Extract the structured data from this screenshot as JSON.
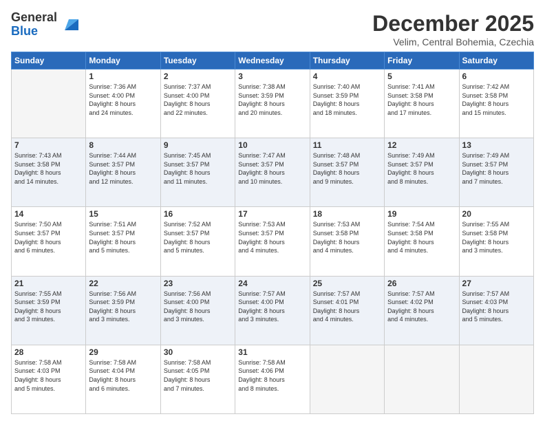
{
  "logo": {
    "general": "General",
    "blue": "Blue"
  },
  "header": {
    "month": "December 2025",
    "location": "Velim, Central Bohemia, Czechia"
  },
  "days_of_week": [
    "Sunday",
    "Monday",
    "Tuesday",
    "Wednesday",
    "Thursday",
    "Friday",
    "Saturday"
  ],
  "weeks": [
    [
      {
        "day": "",
        "info": ""
      },
      {
        "day": "1",
        "info": "Sunrise: 7:36 AM\nSunset: 4:00 PM\nDaylight: 8 hours\nand 24 minutes."
      },
      {
        "day": "2",
        "info": "Sunrise: 7:37 AM\nSunset: 4:00 PM\nDaylight: 8 hours\nand 22 minutes."
      },
      {
        "day": "3",
        "info": "Sunrise: 7:38 AM\nSunset: 3:59 PM\nDaylight: 8 hours\nand 20 minutes."
      },
      {
        "day": "4",
        "info": "Sunrise: 7:40 AM\nSunset: 3:59 PM\nDaylight: 8 hours\nand 18 minutes."
      },
      {
        "day": "5",
        "info": "Sunrise: 7:41 AM\nSunset: 3:58 PM\nDaylight: 8 hours\nand 17 minutes."
      },
      {
        "day": "6",
        "info": "Sunrise: 7:42 AM\nSunset: 3:58 PM\nDaylight: 8 hours\nand 15 minutes."
      }
    ],
    [
      {
        "day": "7",
        "info": "Sunrise: 7:43 AM\nSunset: 3:58 PM\nDaylight: 8 hours\nand 14 minutes."
      },
      {
        "day": "8",
        "info": "Sunrise: 7:44 AM\nSunset: 3:57 PM\nDaylight: 8 hours\nand 12 minutes."
      },
      {
        "day": "9",
        "info": "Sunrise: 7:45 AM\nSunset: 3:57 PM\nDaylight: 8 hours\nand 11 minutes."
      },
      {
        "day": "10",
        "info": "Sunrise: 7:47 AM\nSunset: 3:57 PM\nDaylight: 8 hours\nand 10 minutes."
      },
      {
        "day": "11",
        "info": "Sunrise: 7:48 AM\nSunset: 3:57 PM\nDaylight: 8 hours\nand 9 minutes."
      },
      {
        "day": "12",
        "info": "Sunrise: 7:49 AM\nSunset: 3:57 PM\nDaylight: 8 hours\nand 8 minutes."
      },
      {
        "day": "13",
        "info": "Sunrise: 7:49 AM\nSunset: 3:57 PM\nDaylight: 8 hours\nand 7 minutes."
      }
    ],
    [
      {
        "day": "14",
        "info": "Sunrise: 7:50 AM\nSunset: 3:57 PM\nDaylight: 8 hours\nand 6 minutes."
      },
      {
        "day": "15",
        "info": "Sunrise: 7:51 AM\nSunset: 3:57 PM\nDaylight: 8 hours\nand 5 minutes."
      },
      {
        "day": "16",
        "info": "Sunrise: 7:52 AM\nSunset: 3:57 PM\nDaylight: 8 hours\nand 5 minutes."
      },
      {
        "day": "17",
        "info": "Sunrise: 7:53 AM\nSunset: 3:57 PM\nDaylight: 8 hours\nand 4 minutes."
      },
      {
        "day": "18",
        "info": "Sunrise: 7:53 AM\nSunset: 3:58 PM\nDaylight: 8 hours\nand 4 minutes."
      },
      {
        "day": "19",
        "info": "Sunrise: 7:54 AM\nSunset: 3:58 PM\nDaylight: 8 hours\nand 4 minutes."
      },
      {
        "day": "20",
        "info": "Sunrise: 7:55 AM\nSunset: 3:58 PM\nDaylight: 8 hours\nand 3 minutes."
      }
    ],
    [
      {
        "day": "21",
        "info": "Sunrise: 7:55 AM\nSunset: 3:59 PM\nDaylight: 8 hours\nand 3 minutes."
      },
      {
        "day": "22",
        "info": "Sunrise: 7:56 AM\nSunset: 3:59 PM\nDaylight: 8 hours\nand 3 minutes."
      },
      {
        "day": "23",
        "info": "Sunrise: 7:56 AM\nSunset: 4:00 PM\nDaylight: 8 hours\nand 3 minutes."
      },
      {
        "day": "24",
        "info": "Sunrise: 7:57 AM\nSunset: 4:00 PM\nDaylight: 8 hours\nand 3 minutes."
      },
      {
        "day": "25",
        "info": "Sunrise: 7:57 AM\nSunset: 4:01 PM\nDaylight: 8 hours\nand 4 minutes."
      },
      {
        "day": "26",
        "info": "Sunrise: 7:57 AM\nSunset: 4:02 PM\nDaylight: 8 hours\nand 4 minutes."
      },
      {
        "day": "27",
        "info": "Sunrise: 7:57 AM\nSunset: 4:03 PM\nDaylight: 8 hours\nand 5 minutes."
      }
    ],
    [
      {
        "day": "28",
        "info": "Sunrise: 7:58 AM\nSunset: 4:03 PM\nDaylight: 8 hours\nand 5 minutes."
      },
      {
        "day": "29",
        "info": "Sunrise: 7:58 AM\nSunset: 4:04 PM\nDaylight: 8 hours\nand 6 minutes."
      },
      {
        "day": "30",
        "info": "Sunrise: 7:58 AM\nSunset: 4:05 PM\nDaylight: 8 hours\nand 7 minutes."
      },
      {
        "day": "31",
        "info": "Sunrise: 7:58 AM\nSunset: 4:06 PM\nDaylight: 8 hours\nand 8 minutes."
      },
      {
        "day": "",
        "info": ""
      },
      {
        "day": "",
        "info": ""
      },
      {
        "day": "",
        "info": ""
      }
    ]
  ]
}
